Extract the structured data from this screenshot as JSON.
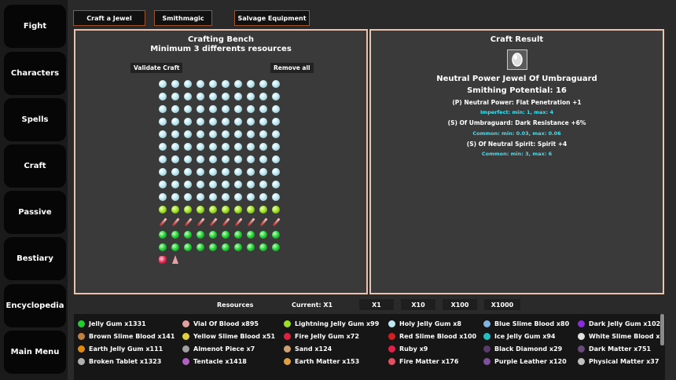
{
  "sidebar": {
    "items": [
      {
        "label": "Fight"
      },
      {
        "label": "Characters"
      },
      {
        "label": "Spells"
      },
      {
        "label": "Craft"
      },
      {
        "label": "Passive"
      },
      {
        "label": "Bestiary"
      },
      {
        "label": "Encyclopedia"
      },
      {
        "label": "Main Menu"
      }
    ]
  },
  "tabs": [
    {
      "label": "Craft a Jewel"
    },
    {
      "label": "Smithmagic"
    },
    {
      "label": "Salvage Equipment"
    }
  ],
  "bench": {
    "title": "Crafting Bench",
    "subtitle": "Minimum 3 differents resources",
    "validate_label": "Validate Craft",
    "remove_label": "Remove all",
    "rows": [
      {
        "kind": "holy",
        "count": 10
      },
      {
        "kind": "holy",
        "count": 10
      },
      {
        "kind": "holy",
        "count": 10
      },
      {
        "kind": "holy",
        "count": 10
      },
      {
        "kind": "holy",
        "count": 10
      },
      {
        "kind": "holy",
        "count": 10
      },
      {
        "kind": "holy",
        "count": 10
      },
      {
        "kind": "holy",
        "count": 10
      },
      {
        "kind": "holy",
        "count": 10
      },
      {
        "kind": "holy",
        "count": 10
      },
      {
        "kind": "lightning",
        "count": 10
      },
      {
        "kind": "vial",
        "count": 10
      },
      {
        "kind": "jelly",
        "count": 10
      },
      {
        "kind": "jelly",
        "count": 10
      },
      {
        "kind": "mixed",
        "count": 2
      }
    ]
  },
  "result": {
    "title": "Craft Result",
    "item_name": "Neutral Power Jewel Of Umbraguard",
    "potential": "Smithing Potential: 16",
    "affixes": [
      {
        "text": "(P) Neutral Power: Flat Penetration +1",
        "range": "Imperfect: min: 1, max: 4"
      },
      {
        "text": "(S) Of Umbraguard: Dark Resistance +6%",
        "range": "Common: min: 0.03, max: 0.06"
      },
      {
        "text": "(S) Of Neutral Spirit: Spirit +4",
        "range": "Common: min: 3, max: 6"
      }
    ]
  },
  "resources_bar": {
    "label": "Resources",
    "current": "Current: X1",
    "multipliers": [
      "X1",
      "X10",
      "X100",
      "X1000"
    ]
  },
  "inventory": [
    [
      {
        "name": "Jelly Gum x1331",
        "icon": "jelly-gum-icon",
        "color": "#22cc33"
      },
      {
        "name": "Vial Of Blood x895",
        "icon": "vial-blood-icon",
        "color": "#e0a0a0"
      },
      {
        "name": "Lightning Jelly Gum x99",
        "icon": "lightning-gum-icon",
        "color": "#9be022"
      },
      {
        "name": "Holy Jelly Gum x8",
        "icon": "holy-gum-icon",
        "color": "#bfe9f2"
      },
      {
        "name": "Blue Slime Blood x80",
        "icon": "blue-blood-icon",
        "color": "#7fb3e0"
      },
      {
        "name": "Dark Jelly Gum x102",
        "icon": "dark-gum-icon",
        "color": "#8a2be2"
      }
    ],
    [
      {
        "name": "Brown Slime Blood x141",
        "icon": "brown-blood-icon",
        "color": "#c08040"
      },
      {
        "name": "Yellow Slime Blood x51",
        "icon": "yellow-blood-icon",
        "color": "#e0d040"
      },
      {
        "name": "Fire Jelly Gum x72",
        "icon": "fire-gum-icon",
        "color": "#e02040"
      },
      {
        "name": "Red Slime Blood x100",
        "icon": "red-blood-icon",
        "color": "#d02020"
      },
      {
        "name": "Ice Jelly Gum x94",
        "icon": "ice-gum-icon",
        "color": "#20c0c0"
      },
      {
        "name": "White Slime Blood x5",
        "icon": "white-blood-icon",
        "color": "#e0e0e0"
      }
    ],
    [
      {
        "name": "Earth Jelly Gum x111",
        "icon": "earth-gum-icon",
        "color": "#e08a10"
      },
      {
        "name": "Almenot Piece x7",
        "icon": "almenot-icon",
        "color": "#a0a0a0"
      },
      {
        "name": "Sand x124",
        "icon": "sand-icon",
        "color": "#d0a070"
      },
      {
        "name": "Ruby x9",
        "icon": "ruby-icon",
        "color": "#e0204a"
      },
      {
        "name": "Black Diamond x29",
        "icon": "black-diamond-icon",
        "color": "#5a3a6a"
      },
      {
        "name": "Dark Matter x751",
        "icon": "dark-matter-icon",
        "color": "#6a4a7a"
      }
    ],
    [
      {
        "name": "Broken Tablet x1323",
        "icon": "tablet-icon",
        "color": "#b0b0b0"
      },
      {
        "name": "Tentacle x1418",
        "icon": "tentacle-icon",
        "color": "#b060c0"
      },
      {
        "name": "Earth Matter x153",
        "icon": "earth-matter-icon",
        "color": "#e0a040"
      },
      {
        "name": "Fire Matter x176",
        "icon": "fire-matter-icon",
        "color": "#e05060"
      },
      {
        "name": "Purple Leather x120",
        "icon": "leather-icon",
        "color": "#8050a0"
      },
      {
        "name": "Physical Matter x37",
        "icon": "physical-matter-icon",
        "color": "#c0c0c0"
      }
    ]
  ]
}
